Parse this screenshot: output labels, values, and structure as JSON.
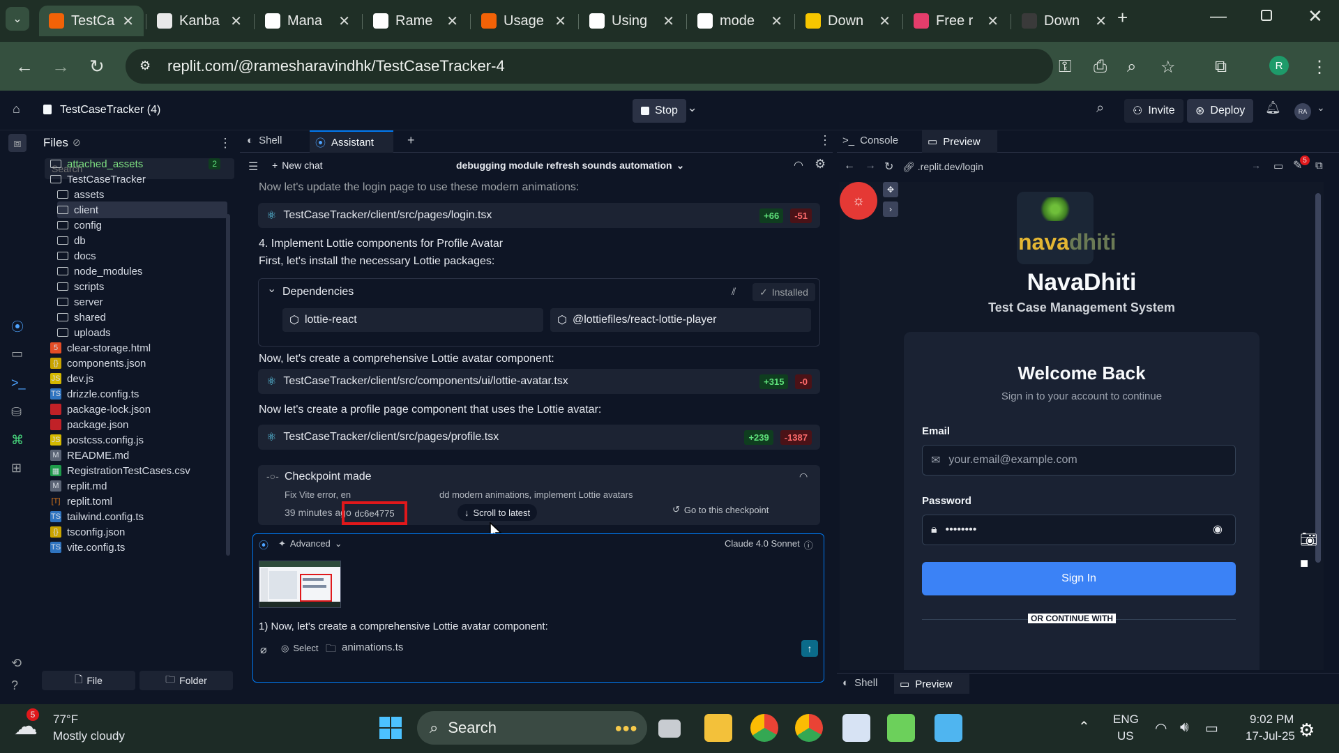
{
  "browser": {
    "tabs": [
      {
        "title": "TestCa",
        "favicon": "replit-favicon"
      },
      {
        "title": "Kanba",
        "favicon": "kanban-favicon"
      },
      {
        "title": "Mana",
        "favicon": "github-favicon"
      },
      {
        "title": "Rame",
        "favicon": "github-favicon"
      },
      {
        "title": "Usage",
        "favicon": "replit-favicon"
      },
      {
        "title": "Using",
        "favicon": "openai-favicon"
      },
      {
        "title": "mode",
        "favicon": "google-favicon"
      },
      {
        "title": "Down",
        "favicon": "dollar-favicon"
      },
      {
        "title": "Free r",
        "favicon": "app-favicon"
      },
      {
        "title": "Down",
        "favicon": "m-favicon"
      }
    ],
    "url": "replit.com/@ramesharavindhk/TestCaseTracker-4",
    "profile_initial": "R"
  },
  "header": {
    "project_name": "TestCaseTracker (4)",
    "stop_label": "Stop",
    "invite_label": "Invite",
    "deploy_label": "Deploy",
    "avatar_initials": "RA"
  },
  "files": {
    "title": "Files",
    "search_placeholder": "Search",
    "items": [
      {
        "name": "attached_assets",
        "type": "folder",
        "badge": "2",
        "color": "#7ee081"
      },
      {
        "name": "TestCaseTracker",
        "type": "folder"
      },
      {
        "name": "assets",
        "type": "folder"
      },
      {
        "name": "client",
        "type": "folder"
      },
      {
        "name": "config",
        "type": "folder"
      },
      {
        "name": "db",
        "type": "folder"
      },
      {
        "name": "docs",
        "type": "folder"
      },
      {
        "name": "node_modules",
        "type": "folder"
      },
      {
        "name": "scripts",
        "type": "folder"
      },
      {
        "name": "server",
        "type": "folder"
      },
      {
        "name": "shared",
        "type": "folder"
      },
      {
        "name": "uploads",
        "type": "folder"
      },
      {
        "name": "clear-storage.html",
        "type": "html"
      },
      {
        "name": "components.json",
        "type": "json"
      },
      {
        "name": "dev.js",
        "type": "js"
      },
      {
        "name": "drizzle.config.ts",
        "type": "ts"
      },
      {
        "name": "package-lock.json",
        "type": "npm"
      },
      {
        "name": "package.json",
        "type": "npm"
      },
      {
        "name": "postcss.config.js",
        "type": "js"
      },
      {
        "name": "README.md",
        "type": "md"
      },
      {
        "name": "RegistrationTestCases.csv",
        "type": "csv"
      },
      {
        "name": "replit.md",
        "type": "md"
      },
      {
        "name": "replit.toml",
        "type": "toml"
      },
      {
        "name": "tailwind.config.ts",
        "type": "ts"
      },
      {
        "name": "tsconfig.json",
        "type": "json"
      },
      {
        "name": "vite.config.ts",
        "type": "ts"
      }
    ],
    "new_file_label": "File",
    "new_folder_label": "Folder"
  },
  "assistant": {
    "tabs": [
      {
        "label": "Shell"
      },
      {
        "label": "Assistant"
      }
    ],
    "new_chat_label": "New chat",
    "chat_title": "debugging module refresh sounds automation",
    "messages": {
      "m1": "Now let's update the login page to use these modern animations:",
      "file1": "TestCaseTracker/client/src/pages/login.tsx",
      "file1_add": "+66",
      "file1_del": "-51",
      "m2": "4. Implement Lottie components for Profile Avatar",
      "m3": "First, let's install the necessary Lottie packages:",
      "deps_title": "Dependencies",
      "deps_status": "Installed",
      "dep1": "lottie-react",
      "dep2": "@lottiefiles/react-lottie-player",
      "m4": "Now, let's create a comprehensive Lottie avatar component:",
      "file2": "TestCaseTracker/client/src/components/ui/lottie-avatar.tsx",
      "file2_add": "+315",
      "file2_del": "-0",
      "m5": "Now let's create a profile page component that uses the Lottie avatar:",
      "file3": "TestCaseTracker/client/src/pages/profile.tsx",
      "file3_add": "+239",
      "file3_del": "-1387",
      "checkpoint_title": "Checkpoint made",
      "checkpoint_desc_a": "Fix Vite error, en",
      "checkpoint_desc_b": "dd modern animations, implement Lottie avatars",
      "checkpoint_time": "39 minutes ago",
      "checkpoint_hash": "dc6e4775",
      "scroll_latest": "Scroll to latest",
      "goto_checkpoint": "Go to this checkpoint"
    },
    "input": {
      "advanced_label": "Advanced",
      "model_label": "Claude 4.0 Sonnet",
      "text": "1) Now, let's create a comprehensive Lottie avatar component:",
      "select_label": "Select",
      "attached_file": "animations.ts"
    }
  },
  "preview": {
    "tabs": [
      {
        "label": "Console"
      },
      {
        "label": "Preview"
      }
    ],
    "url": ".replit.dev/login",
    "notif_count": "5",
    "logo_text_a": "nava",
    "logo_text_b": "dhiti",
    "app_title": "NavaDhiti",
    "app_subtitle": "Test Case Management System",
    "welcome": "Welcome Back",
    "welcome_sub": "Sign in to your account to continue",
    "email_label": "Email",
    "email_placeholder": "your.email@example.com",
    "password_label": "Password",
    "password_value": "••••••••",
    "signin_label": "Sign In",
    "or_continue": "OR CONTINUE WITH",
    "bottom_tabs": [
      {
        "label": "Shell"
      },
      {
        "label": "Preview"
      }
    ]
  },
  "taskbar": {
    "weather_temp": "77°F",
    "weather_desc": "Mostly cloudy",
    "weather_badge": "5",
    "search_label": "Search",
    "lang_a": "ENG",
    "lang_b": "US",
    "time": "9:02 PM",
    "date": "17-Jul-25"
  },
  "colors": {
    "accent_blue": "#3b82f6",
    "highlight_red": "#e0181b",
    "chrome_green": "#35503f"
  }
}
